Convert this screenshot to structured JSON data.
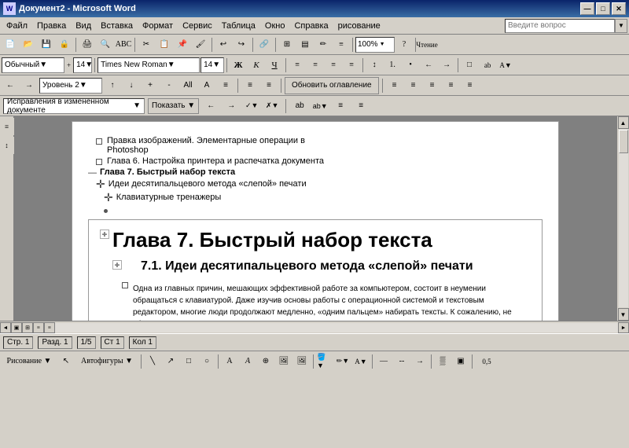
{
  "titlebar": {
    "title": "Документ2 - Microsoft Word",
    "minimize": "—",
    "maximize": "□",
    "close": "✕"
  },
  "menubar": {
    "items": [
      "Файл",
      "Правка",
      "Вид",
      "Вставка",
      "Формат",
      "Сервис",
      "Таблица",
      "Окно",
      "Справка",
      "рисование"
    ],
    "help_placeholder": "Введите вопрос"
  },
  "outline_toolbar": {
    "level": "Уровень 2",
    "update_toc": "Обновить оглавление"
  },
  "tracking_toolbar": {
    "tracking_mode": "Исправления в измененном документе",
    "show": "Показать ▼"
  },
  "outline_items": [
    {
      "indent": 2,
      "type": "bullet",
      "text": "Правка изображений. Элементарные операции в Photoshop"
    },
    {
      "indent": 2,
      "type": "bullet",
      "text": "Глава 6. Настройка принтера и распечатка документа"
    },
    {
      "indent": 1,
      "type": "dash",
      "text": "Глава 7. Быстрый набор текста"
    },
    {
      "indent": 1,
      "type": "cross",
      "text": "Идеи десятипальцевого метода «слепой» печати"
    },
    {
      "indent": 2,
      "type": "cross",
      "text": "Клавиатурные тренажеры"
    },
    {
      "indent": 2,
      "type": "dot",
      "text": ""
    }
  ],
  "document": {
    "chapter_title": "Глава 7. Быстрый набор текста",
    "subheading": "7.1. Идеи десятипальцевого метода «слепой» печати",
    "body_text": "Одна из главных причин, мешающих эффективной работе за компьютером, состоит в неумении обращаться с клавиатурой. Даже изучив основы работы с операционной системой и текстовым редактором, многие люди продолжают медленно, «одним пальцем» набирать тексты. К сожалению, не сформировав навык эти не"
  },
  "statusbar": {
    "page": "Стр. 1",
    "section": "Разд. 1",
    "position": "1/5",
    "line": "Ст 1",
    "col": "Кол 1"
  },
  "bottom": {
    "drawing_label": "Рисование ▼",
    "autoshapes_label": "Автофигуры ▼",
    "zoom_value": "0,5"
  }
}
